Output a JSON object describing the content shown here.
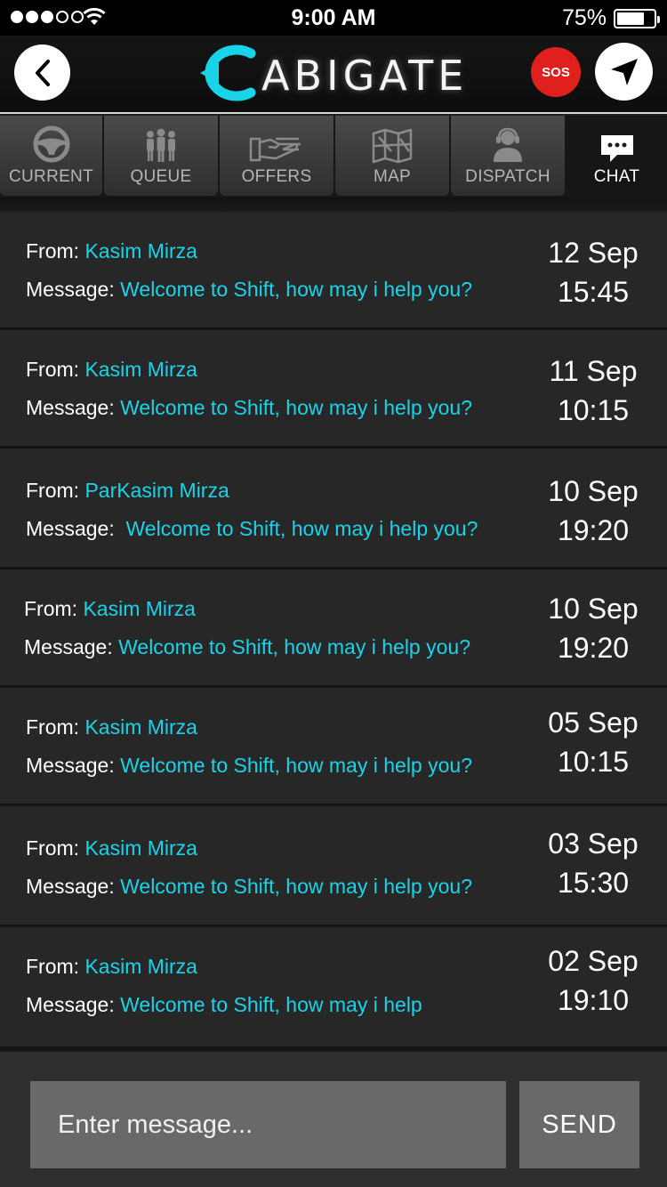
{
  "status_bar": {
    "time": "9:00 AM",
    "battery": "75%",
    "battery_level": 0.75,
    "signal_bars": 3
  },
  "header": {
    "logo": "ABIGATE",
    "sos_label": "SOS",
    "logo_color": "#19d3e8",
    "sos_color": "#e0201c"
  },
  "tabs": [
    {
      "label": "CURRENT",
      "icon": "steering-wheel-icon"
    },
    {
      "label": "QUEUE",
      "icon": "people-queue-icon"
    },
    {
      "label": "OFFERS",
      "icon": "hand-offer-icon"
    },
    {
      "label": "MAP",
      "icon": "map-icon"
    },
    {
      "label": "DISPATCH",
      "icon": "dispatcher-headset-icon"
    },
    {
      "label": "CHAT",
      "icon": "chat-bubble-icon",
      "active": true
    }
  ],
  "labels": {
    "from": "From:",
    "message": "Message:"
  },
  "messages": [
    {
      "sender": "Kasim Mirza",
      "text": "Welcome to Shift, how may i help you?",
      "date": "12 Sep",
      "time": "15:45"
    },
    {
      "sender": "Kasim Mirza",
      "text": "Welcome to Shift, how may i help you?",
      "date": "11 Sep",
      "time": "10:15"
    },
    {
      "sender": "ParKasim Mirza",
      "text": "Welcome to Shift, how may i help you?",
      "date": "10 Sep",
      "time": "19:20"
    },
    {
      "sender": "Kasim Mirza",
      "text": "Welcome to Shift, how may i help you?",
      "date": "10 Sep",
      "time": "19:20"
    },
    {
      "sender": "Kasim Mirza",
      "text": "Welcome to Shift, how may i help you?",
      "date": "05 Sep",
      "time": "10:15"
    },
    {
      "sender": "Kasim Mirza",
      "text": "Welcome to Shift, how may i help you?",
      "date": "03 Sep",
      "time": "15:30"
    },
    {
      "sender": "Kasim Mirza",
      "text": "Welcome to Shift, how may i help",
      "date": "02 Sep",
      "time": "19:10"
    }
  ],
  "composer": {
    "placeholder": "Enter message...",
    "value": "",
    "send_label": "SEND"
  }
}
